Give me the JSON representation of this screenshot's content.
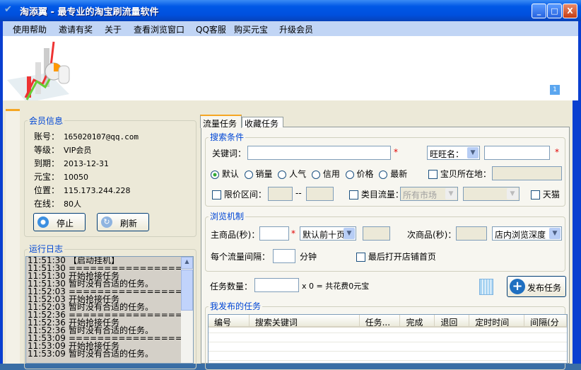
{
  "window": {
    "title": "淘添翼 - 最专业的淘宝刷流量软件",
    "min": "_",
    "max": "□",
    "close": "X"
  },
  "menu": [
    "使用帮助",
    "邀请有奖",
    "关于",
    "查看浏览窗口",
    "QQ客服",
    "购买元宝",
    "升级会员"
  ],
  "banner": {
    "badge": "1"
  },
  "member": {
    "title": "会员信息",
    "rows": [
      {
        "label": "账号：",
        "value": "165020107@qq.com"
      },
      {
        "label": "等级：",
        "value": "VIP会员"
      },
      {
        "label": "到期：",
        "value": "2013-12-31"
      },
      {
        "label": "元宝：",
        "value": "10050"
      },
      {
        "label": "位置：",
        "value": "115.173.244.228"
      },
      {
        "label": "在线：",
        "value": "80人"
      }
    ],
    "stop": "停止",
    "refresh": "刷新"
  },
  "log": {
    "title": "运行日志",
    "rows": [
      [
        "11:51:30",
        "【启动挂机】"
      ],
      [
        "11:51:30",
        "=============================="
      ],
      [
        "11:51:30",
        "开始抢接任务"
      ],
      [
        "11:51:30",
        "暂时没有合适的任务。"
      ],
      [
        "11:52:03",
        "=============================="
      ],
      [
        "11:52:03",
        "开始抢接任务"
      ],
      [
        "11:52:03",
        "暂时没有合适的任务。"
      ],
      [
        "11:52:36",
        "=============================="
      ],
      [
        "11:52:36",
        "开始抢接任务"
      ],
      [
        "11:52:36",
        "暂时没有合适的任务。"
      ],
      [
        "11:53:09",
        "=============================="
      ],
      [
        "11:53:09",
        "开始抢接任务"
      ],
      [
        "11:53:09",
        "暂时没有合适的任务。"
      ]
    ]
  },
  "tabs": [
    "流量任务",
    "收藏任务"
  ],
  "search": {
    "title": "搜索条件",
    "keyword": "关键词：",
    "wangwang": "旺旺名：",
    "sorts": [
      "默认",
      "销量",
      "人气",
      "信用",
      "价格",
      "最新"
    ],
    "location": "宝贝所在地：",
    "price": "限价区间：",
    "dash": "--",
    "category": "类目流量：",
    "market": "所有市场",
    "tmall": "天猫",
    "star": "*"
  },
  "browse": {
    "title": "浏览机制",
    "main": "主商品(秒)：",
    "main_sel": "默认前十页",
    "sub": "次商品(秒)：",
    "sub_sel": "店内浏览深度",
    "interval": "每个流量间隔：",
    "minute": "分钟",
    "last_shop": "最后打开店铺首页"
  },
  "task": {
    "count_label": "任务数量：",
    "formula": "x 0 = 共花费0元宝",
    "publish": "发布任务"
  },
  "my_tasks": {
    "title": "我发布的任务",
    "columns": [
      "编号",
      "搜索关键词",
      "任务...",
      "完成",
      "退回",
      "定时时间",
      "间隔(分"
    ]
  }
}
